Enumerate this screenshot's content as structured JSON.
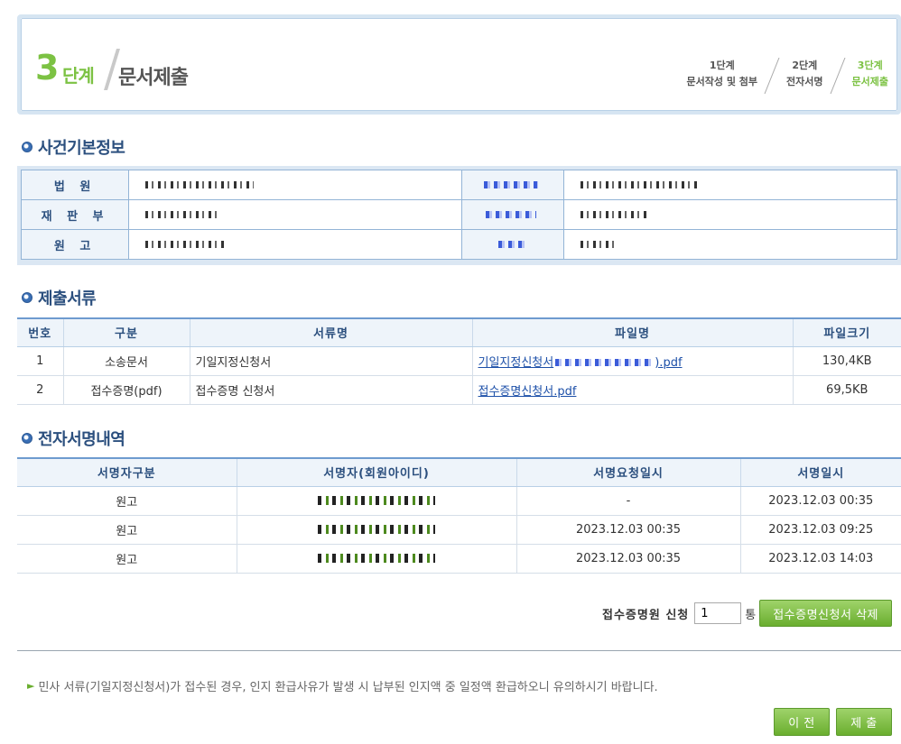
{
  "header": {
    "step_number": "3",
    "step_unit": "단계",
    "title": "문서제출",
    "steps": [
      {
        "line1": "1단계",
        "line2": "문서작성 및 첨부",
        "active": false
      },
      {
        "line1": "2단계",
        "line2": "전자서명",
        "active": false
      },
      {
        "line1": "3단계",
        "line2": "문서제출",
        "active": true
      }
    ]
  },
  "case_info": {
    "title": "사건기본정보",
    "rows": [
      {
        "label": "법 원"
      },
      {
        "label": "재 판 부"
      },
      {
        "label": "원 고"
      }
    ]
  },
  "documents": {
    "title": "제출서류",
    "headers": [
      "번호",
      "구분",
      "서류명",
      "파일명",
      "파일크기"
    ],
    "rows": [
      {
        "no": "1",
        "category": "소송문서",
        "name": "기일지정신청서",
        "file_prefix": "기일지정신청서",
        "file_suffix": ").pdf",
        "size": "130,4KB"
      },
      {
        "no": "2",
        "category": "접수증명(pdf)",
        "name": "접수증명 신청서",
        "file": "접수증명신청서.pdf",
        "size": "69,5KB"
      }
    ]
  },
  "signatures": {
    "title": "전자서명내역",
    "headers": [
      "서명자구분",
      "서명자(회원아이디)",
      "서명요청일시",
      "서명일시"
    ],
    "rows": [
      {
        "type": "원고",
        "requested": "-",
        "signed": "2023.12.03 00:35"
      },
      {
        "type": "원고",
        "requested": "2023.12.03 00:35",
        "signed": "2023.12.03 09:25"
      },
      {
        "type": "원고",
        "requested": "2023.12.03 00:35",
        "signed": "2023.12.03 14:03"
      }
    ]
  },
  "receipt": {
    "label": "접수증명원 신청",
    "value": "1",
    "unit": "통",
    "delete_button": "접수증명신청서 삭제"
  },
  "notice": "민사 서류(기일지정신청서)가 접수된 경우, 인지 환급사유가 발생 시 납부된 인지액 중 일정액 환급하오니 유의하시기 바랍니다.",
  "buttons": {
    "prev": "이 전",
    "submit": "제 출"
  },
  "colors": {
    "accent_green": "#7cc243",
    "heading_blue": "#2b4f7e",
    "link_blue": "#1c4fa8"
  }
}
